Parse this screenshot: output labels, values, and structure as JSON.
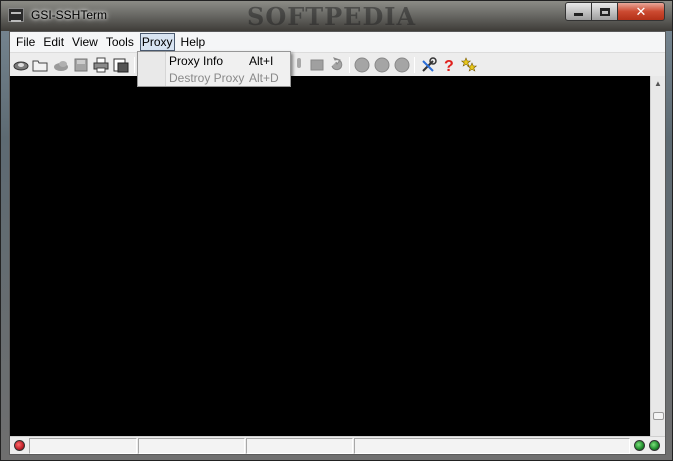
{
  "window": {
    "title": "GSI-SSHTerm",
    "watermark": "SOFTPEDIA",
    "controls": {
      "minimize": "minimize",
      "maximize": "maximize",
      "close": "✕"
    }
  },
  "menubar": {
    "items": [
      {
        "label": "File"
      },
      {
        "label": "Edit"
      },
      {
        "label": "View"
      },
      {
        "label": "Tools"
      },
      {
        "label": "Proxy",
        "active": true
      },
      {
        "label": "Help"
      }
    ]
  },
  "toolbar": {
    "buttons": [
      {
        "icon": "connect-icon"
      },
      {
        "icon": "open-folder-icon"
      },
      {
        "icon": "disconnect-icon",
        "disabled": true
      },
      {
        "icon": "save-icon",
        "disabled": true
      },
      {
        "icon": "print-icon"
      },
      {
        "icon": "print-preview-icon"
      },
      {
        "icon": "mic-icon",
        "disabled": true
      },
      {
        "icon": "terminal-icon",
        "disabled": true
      },
      {
        "icon": "refresh-icon",
        "disabled": true
      },
      {
        "icon": "record-icon",
        "disabled": true
      },
      {
        "icon": "stop-icon",
        "disabled": true
      },
      {
        "icon": "play-icon",
        "disabled": true
      },
      {
        "icon": "tools-icon"
      },
      {
        "icon": "help-icon"
      },
      {
        "icon": "keys-icon"
      }
    ]
  },
  "proxy_menu": {
    "items": [
      {
        "label": "Proxy Info",
        "shortcut": "Alt+I",
        "enabled": true
      },
      {
        "label": "Destroy Proxy",
        "shortcut": "Alt+D",
        "enabled": false
      }
    ]
  },
  "statusbar": {
    "left_led": "red",
    "right_leds": [
      "green",
      "green"
    ]
  },
  "colors": {
    "terminal_bg": "#000000",
    "led_red": "#c0202a",
    "led_green": "#1d8a2a",
    "help_red": "#e0201c",
    "keys_yellow": "#e8c81a"
  }
}
